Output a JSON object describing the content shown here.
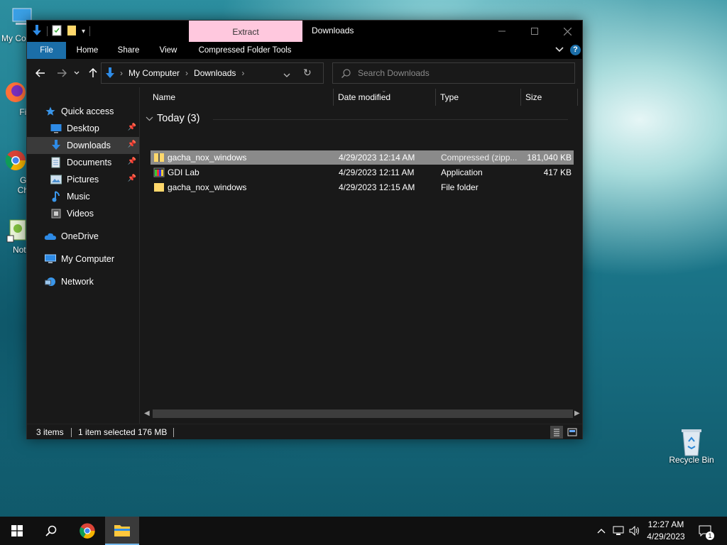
{
  "desktop": {
    "icons": [
      {
        "label": "My Co",
        "icon": "computer-icon"
      },
      {
        "label": "Fire",
        "icon": "firefox-icon"
      },
      {
        "label": "Go",
        "label2": "Chr",
        "icon": "chrome-icon"
      },
      {
        "label": "Notep",
        "icon": "notepad-icon"
      },
      {
        "label": "Recycle Bin",
        "icon": "recycle-bin-icon"
      }
    ]
  },
  "window": {
    "title": "Downloads",
    "context_tab": "Extract",
    "accent_color": "#1b6ea8",
    "context_color": "#ffc8de",
    "ribbon_tabs": [
      "File",
      "Home",
      "Share",
      "View",
      "Compressed Folder Tools"
    ],
    "address": {
      "crumbs": [
        "My Computer",
        "Downloads"
      ]
    },
    "search": {
      "placeholder": "Search Downloads",
      "value": ""
    }
  },
  "nav_pane": {
    "items": [
      {
        "label": "Quick access",
        "icon": "star-icon",
        "pinned": false,
        "selected": false
      },
      {
        "label": "Desktop",
        "icon": "desktop-icon",
        "pinned": true,
        "selected": false
      },
      {
        "label": "Downloads",
        "icon": "download-arrow-icon",
        "pinned": true,
        "selected": true
      },
      {
        "label": "Documents",
        "icon": "documents-icon",
        "pinned": true,
        "selected": false
      },
      {
        "label": "Pictures",
        "icon": "pictures-icon",
        "pinned": true,
        "selected": false
      },
      {
        "label": "Music",
        "icon": "music-icon",
        "pinned": false,
        "selected": false
      },
      {
        "label": "Videos",
        "icon": "videos-icon",
        "pinned": false,
        "selected": false
      },
      {
        "label": "OneDrive",
        "icon": "cloud-icon",
        "pinned": false,
        "selected": false
      },
      {
        "label": "My Computer",
        "icon": "computer-icon",
        "pinned": false,
        "selected": false
      },
      {
        "label": "Network",
        "icon": "network-icon",
        "pinned": false,
        "selected": false
      }
    ]
  },
  "file_list": {
    "columns": [
      "Name",
      "Date modified",
      "Type",
      "Size"
    ],
    "group": "Today (3)",
    "rows": [
      {
        "name": "gacha_nox_windows",
        "date": "4/29/2023 12:14 AM",
        "type": "Compressed (zipp...",
        "size": "181,040 KB",
        "icon": "zip-folder-icon",
        "selected": true
      },
      {
        "name": "GDI Lab",
        "date": "4/29/2023 12:11 AM",
        "type": "Application",
        "size": "417 KB",
        "icon": "application-icon",
        "selected": false
      },
      {
        "name": "gacha_nox_windows",
        "date": "4/29/2023 12:15 AM",
        "type": "File folder",
        "size": "",
        "icon": "folder-icon",
        "selected": false
      }
    ]
  },
  "status_bar": {
    "items_count": "3 items",
    "selection": "1 item selected",
    "selection_size": "176 MB"
  },
  "taskbar": {
    "time": "12:27 AM",
    "date": "4/29/2023",
    "notification_count": "1"
  }
}
